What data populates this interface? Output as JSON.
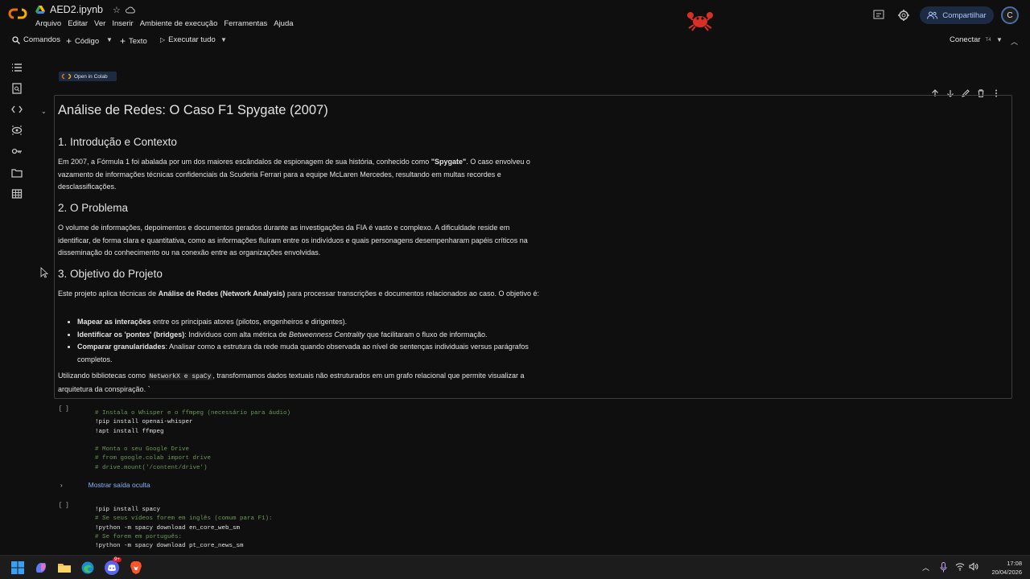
{
  "header": {
    "file_name": "AED2.ipynb",
    "menu": [
      "Arquivo",
      "Editar",
      "Ver",
      "Inserir",
      "Ambiente de execução",
      "Ferramentas",
      "Ajuda"
    ],
    "share_label": "Compartilhar",
    "avatar_letter": "C"
  },
  "toolbar": {
    "commands": "Comandos",
    "code": "Código",
    "text": "Texto",
    "run_all": "Executar tudo",
    "connect": "Conectar",
    "connect_badge": "T4"
  },
  "notebook": {
    "colab_badge": "Open in Colab",
    "markdown": {
      "title": "Análise de Redes: O Caso F1 Spygate (2007)",
      "s1_heading": "1. Introdução e Contexto",
      "s1_p_a": "Em 2007, a Fórmula 1 foi abalada por um dos maiores escândalos de espionagem de sua história, conhecido como ",
      "s1_p_b": "\"Spygate\"",
      "s1_p_c": ". O caso envolveu o vazamento de informações técnicas confidenciais da Scuderia Ferrari para a equipe McLaren Mercedes, resultando em multas recordes e desclassificações.",
      "s2_heading": "2. O Problema",
      "s2_p": "O volume de informações, depoimentos e documentos gerados durante as investigações da FIA é vasto e complexo. A dificuldade reside em identificar, de forma clara e quantitativa, como as informações fluíram entre os indivíduos e quais personagens desempenharam papéis críticos na disseminação do conhecimento ou na conexão entre as organizações envolvidas.",
      "s3_heading": "3. Objetivo do Projeto",
      "s3_p_a": "Este projeto aplica técnicas de ",
      "s3_p_b": "Análise de Redes (Network Analysis)",
      "s3_p_c": " para processar transcrições e documentos relacionados ao caso. O objetivo é:",
      "bullet1_b": "Mapear as interações",
      "bullet1_t": " entre os principais atores (pilotos, engenheiros e dirigentes).",
      "bullet2_b": "Identificar os 'pontes' (bridges)",
      "bullet2_t1": ": Indivíduos com alta métrica de ",
      "bullet2_i": "Betweenness Centrality",
      "bullet2_t2": " que facilitaram o fluxo de informação.",
      "bullet3_b": "Comparar granularidades",
      "bullet3_t": ": Analisar como a estrutura da rede muda quando observada ao nível de sentenças individuais versus parágrafos completos.",
      "closing_a": "Utilizando bibliotecas como ",
      "closing_code": "NetworkX e spaCy",
      "closing_b": ", transformamos dados textuais não estruturados em um grafo relacional que permite visualizar a arquitetura da conspiração. `"
    },
    "cell1": {
      "bracket": "[ ]",
      "lines": [
        {
          "text": "# Instala o Whisper e o ffmpeg (necessário para áudio)",
          "kind": "comment"
        },
        {
          "text": "!pip install openai-whisper",
          "kind": "code"
        },
        {
          "text": "!apt install ffmpeg",
          "kind": "code"
        },
        {
          "text": "",
          "kind": "code"
        },
        {
          "text": "# Monta o seu Google Drive",
          "kind": "comment"
        },
        {
          "text": "# from google.colab import drive",
          "kind": "comment"
        },
        {
          "text": "# drive.mount('/content/drive')",
          "kind": "comment"
        }
      ],
      "hidden_output": "Mostrar saída oculta"
    },
    "cell2": {
      "bracket": "[ ]",
      "lines": [
        {
          "text": "!pip install spacy",
          "kind": "code"
        },
        {
          "text": "# Se seus vídeos forem em inglês (comum para F1):",
          "kind": "comment"
        },
        {
          "text": "!python -m spacy download en_core_web_sm",
          "kind": "code"
        },
        {
          "text": "# Se forem em português:",
          "kind": "comment"
        },
        {
          "text": "!python -m spacy download pt_core_news_sm",
          "kind": "code"
        }
      ]
    }
  },
  "taskbar": {
    "time": "17:08",
    "date": "20/04/2026",
    "discord_badge": "9+"
  },
  "colors": {
    "background": "#0f0f0f",
    "accent": "#a8c7fa",
    "link": "#8ab4f8",
    "comment": "#6a9955",
    "colab_orange": "#f9ab00"
  }
}
